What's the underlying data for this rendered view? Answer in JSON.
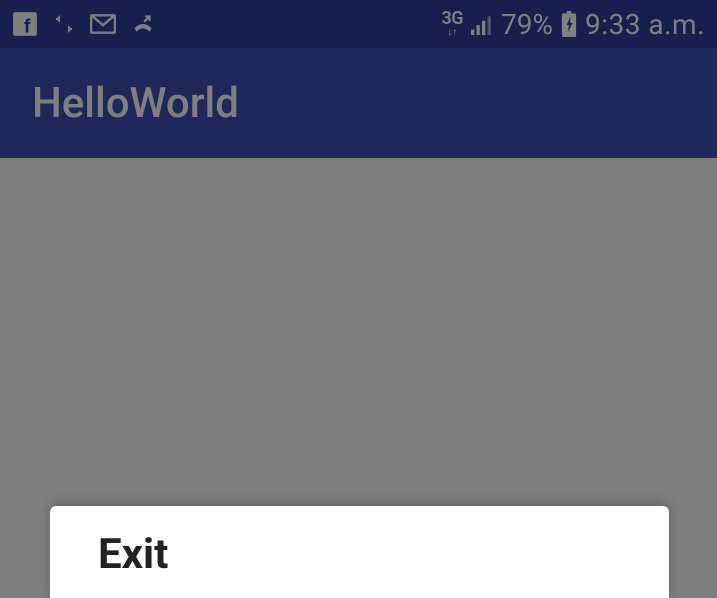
{
  "status": {
    "network_label": "3G",
    "battery_pct": "79%",
    "clock": "9:33 a.m."
  },
  "app": {
    "title": "HelloWorld"
  },
  "dialog": {
    "title": "Exit"
  }
}
